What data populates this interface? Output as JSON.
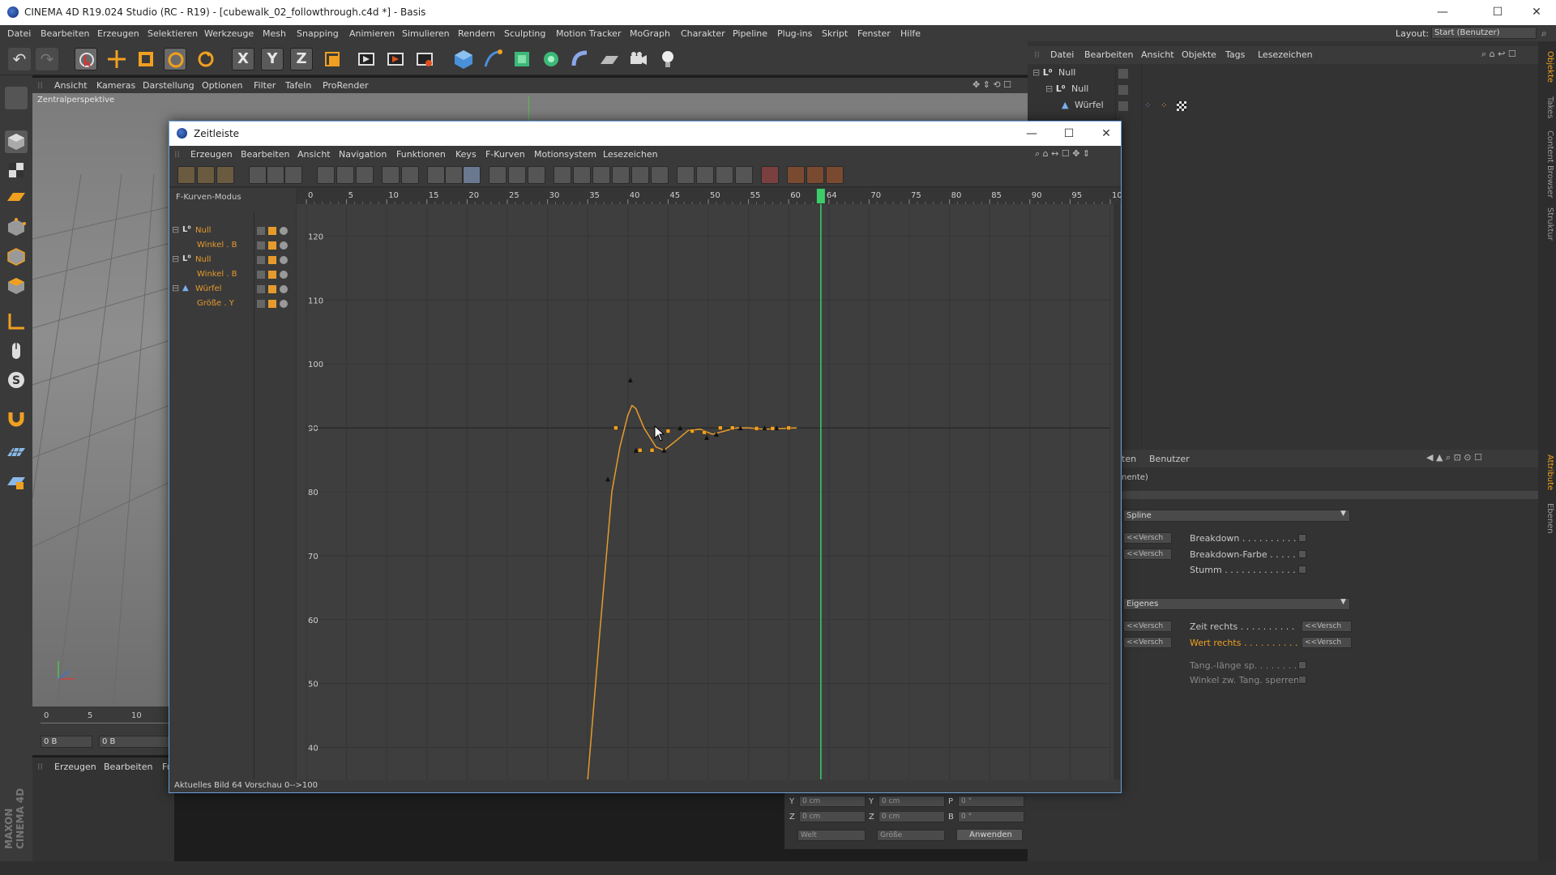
{
  "app": {
    "title": "CINEMA 4D R19.024 Studio (RC - R19) - [cubewalk_02_followthrough.c4d *] - Basis",
    "layout_label": "Layout:",
    "layout_value": "Start (Benutzer)"
  },
  "menubar": [
    "Datei",
    "Bearbeiten",
    "Erzeugen",
    "Selektieren",
    "Werkzeuge",
    "Mesh",
    "Snapping",
    "Animieren",
    "Simulieren",
    "Rendern",
    "Sculpting",
    "Motion Tracker",
    "MoGraph",
    "Charakter",
    "Pipeline",
    "Plug-ins",
    "Skript",
    "Fenster",
    "Hilfe"
  ],
  "viewport": {
    "menu": [
      "Ansicht",
      "Kameras",
      "Darstellung",
      "Optionen",
      "Filter",
      "Tafeln",
      "ProRender"
    ],
    "label": "Zentralperspektive"
  },
  "object_manager": {
    "menu": [
      "Datei",
      "Bearbeiten",
      "Ansicht",
      "Objekte",
      "Tags",
      "Lesezeichen"
    ],
    "items": [
      "Null",
      "Null",
      "Würfel"
    ]
  },
  "attribute_manager": {
    "header_left": "ten",
    "header_right": "Benutzer",
    "sub_left": "nente)",
    "dropdown_spline": "Spline",
    "dropdown_eigenes": "Eigenes",
    "fields": {
      "versch": "<<Versch"
    },
    "labels": {
      "breakdown": "Breakdown . . . . . . . . . . .",
      "breakdown_farbe": "Breakdown-Farbe . . . . . . .",
      "stumm": "Stumm . . . . . . . . . . . . .",
      "zeit_rechts": "Zeit rechts . . . . . . . . . .",
      "wert_rechts": "Wert rechts . . . . . . . . . .",
      "tang_laenge": "Tang.-länge sp. . . . . . . .",
      "winkel_tang": "Winkel zw. Tang. sperren"
    }
  },
  "coords": {
    "y_label": "Y",
    "z_label": "Z",
    "p_label": "P",
    "b_label": "B",
    "y_val": "0 cm",
    "z_val": "0 cm",
    "p_val": "0 °",
    "b_val": "0 °",
    "welt": "Welt",
    "groesse": "Größe",
    "apply": "Anwenden"
  },
  "bottom_left": {
    "ruler_0": "0",
    "ruler_5": "5",
    "ruler_10": "10",
    "field_a": "0 B",
    "field_b": "0 B",
    "menu": [
      "Erzeugen",
      "Bearbeiten",
      "Fu"
    ],
    "brand": "MAXON CINEMA 4D"
  },
  "zeitleiste": {
    "title": "Zeitleiste",
    "menu": [
      "Erzeugen",
      "Bearbeiten",
      "Ansicht",
      "Navigation",
      "Funktionen",
      "Keys",
      "F-Kurven",
      "Motionsystem",
      "Lesezeichen"
    ],
    "mode_label": "F-Kurven-Modus",
    "tracks": [
      {
        "label": "Null",
        "indent": 0,
        "type": "null"
      },
      {
        "label": "Winkel . B",
        "indent": 1,
        "type": "param"
      },
      {
        "label": "Null",
        "indent": 0,
        "type": "null"
      },
      {
        "label": "Winkel . B",
        "indent": 1,
        "type": "param"
      },
      {
        "label": "Würfel",
        "indent": 0,
        "type": "cube"
      },
      {
        "label": "Größe . Y",
        "indent": 1,
        "type": "param"
      }
    ],
    "status": "Aktuelles Bild  64  Vorschau  0-->100",
    "current_frame": 64,
    "current_frame_label": "64"
  },
  "chart_data": {
    "type": "line",
    "title": "",
    "xlabel": "",
    "ylabel": "",
    "xlim": [
      0,
      100
    ],
    "ylim": [
      35,
      125
    ],
    "x_ticks": [
      0,
      5,
      10,
      15,
      20,
      25,
      30,
      35,
      40,
      45,
      50,
      55,
      60,
      65,
      70,
      75,
      80,
      85,
      90,
      95,
      100
    ],
    "x_tick_labels": [
      "0",
      "5",
      "10",
      "15",
      "20",
      "25",
      "30",
      "35",
      "40",
      "45",
      "50",
      "55",
      "60",
      "",
      "70",
      "75",
      "80",
      "85",
      "90",
      "95",
      "100"
    ],
    "y_ticks": [
      40,
      50,
      60,
      70,
      80,
      90,
      100,
      110,
      120
    ],
    "current_frame": 64,
    "series": [
      {
        "curve": [
          [
            35,
            35
          ],
          [
            36.5,
            58
          ],
          [
            38,
            80
          ],
          [
            39,
            87
          ],
          [
            40,
            92
          ],
          [
            40.5,
            93.5
          ],
          [
            41,
            93
          ],
          [
            42,
            90
          ],
          [
            43.5,
            87
          ],
          [
            44.5,
            86.5
          ],
          [
            46,
            88
          ],
          [
            47.5,
            89.6
          ],
          [
            49,
            89.8
          ],
          [
            50.5,
            89
          ],
          [
            52,
            89.5
          ],
          [
            53.5,
            90
          ],
          [
            55,
            90
          ],
          [
            57,
            89.8
          ],
          [
            59,
            89.9
          ],
          [
            61,
            90
          ]
        ],
        "keys": [
          [
            38.5,
            90
          ],
          [
            41.5,
            86.5
          ],
          [
            43,
            86.5
          ],
          [
            45,
            89.5
          ],
          [
            48,
            89.5
          ],
          [
            49.5,
            89.3
          ],
          [
            51.5,
            90
          ],
          [
            53,
            90
          ],
          [
            56,
            89.9
          ],
          [
            58,
            89.9
          ],
          [
            60,
            90
          ]
        ],
        "handles": [
          [
            37.5,
            82
          ],
          [
            40.3,
            97.5
          ],
          [
            41,
            86.5
          ],
          [
            44.5,
            86.5
          ],
          [
            46.5,
            90
          ],
          [
            49.8,
            88.5
          ],
          [
            51,
            89
          ],
          [
            54,
            90
          ],
          [
            57,
            90
          ],
          [
            58.5,
            90
          ]
        ]
      }
    ]
  }
}
